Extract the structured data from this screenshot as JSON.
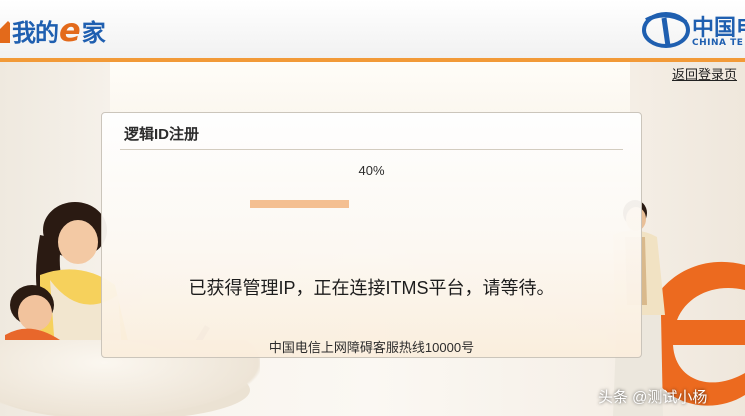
{
  "header": {
    "logo": {
      "text_a": "我的",
      "text_e": "e",
      "text_b": "家"
    },
    "brand": {
      "cn": "中国电",
      "en": "CHINA TE"
    }
  },
  "back_link": "返回登录页",
  "panel": {
    "title": "逻辑ID注册",
    "progress_text": "40%",
    "progress": 0.4,
    "status_message": "已获得管理IP，正在连接ITMS平台，请等待。",
    "hotline": "中国电信上网障碍客服热线10000号"
  },
  "watermark": "头条 @测试小杨",
  "colors": {
    "accent_line": "#f29a38",
    "brand_blue": "#1f5fb0",
    "logo_e": "#e36a1b",
    "progress_fill": "#f4bd8c"
  }
}
